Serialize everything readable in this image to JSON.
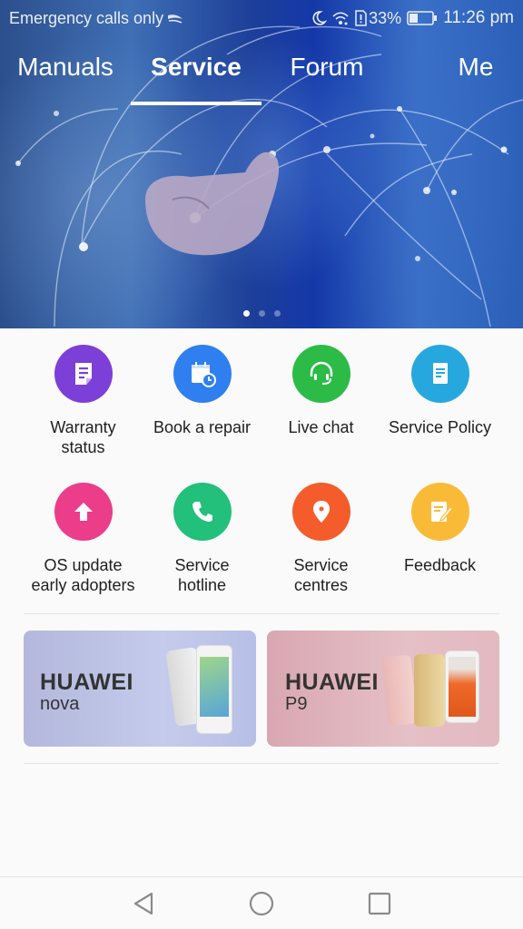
{
  "status_bar": {
    "carrier_text": "Emergency calls only",
    "battery_percent": "33%",
    "time": "11:26 pm",
    "icons": [
      "signal-swoosh-icon",
      "moon-icon",
      "wifi-icon",
      "sim-alert-icon",
      "battery-icon"
    ]
  },
  "tabs": [
    {
      "label": "Manuals",
      "active": false
    },
    {
      "label": "Service",
      "active": true
    },
    {
      "label": "Forum",
      "active": false
    },
    {
      "label": "Me",
      "active": false
    }
  ],
  "carousel": {
    "pages": 3,
    "active_index": 0
  },
  "service_items": [
    {
      "label": "Warranty status",
      "icon": "document-icon",
      "color": "#7c3fd8"
    },
    {
      "label": "Book a repair",
      "icon": "calendar-clock-icon",
      "color": "#2f7ff0"
    },
    {
      "label": "Live chat",
      "icon": "headset-icon",
      "color": "#2dbb47"
    },
    {
      "label": "Service Policy",
      "icon": "policy-document-icon",
      "color": "#26a8de"
    },
    {
      "label": "OS update early adopters",
      "icon": "upload-arrow-icon",
      "color": "#ec3d8a"
    },
    {
      "label": "Service hotline",
      "icon": "phone-icon",
      "color": "#22c07a"
    },
    {
      "label": "Service centres",
      "icon": "location-pin-icon",
      "color": "#f45d2b"
    },
    {
      "label": "Feedback",
      "icon": "edit-note-icon",
      "color": "#f9bb37"
    }
  ],
  "service_labels": {
    "warranty_l1": "Warranty",
    "warranty_l2": "status",
    "book": "Book a repair",
    "chat": "Live chat",
    "policy": "Service Policy",
    "os_l1": "OS update",
    "os_l2": "early adopters",
    "hotline_l1": "Service",
    "hotline_l2": "hotline",
    "centres_l1": "Service",
    "centres_l2": "centres",
    "feedback": "Feedback"
  },
  "banners": [
    {
      "brand": "HUAWEI",
      "model": "nova"
    },
    {
      "brand": "HUAWEI",
      "model": "P9"
    }
  ],
  "nav_bar": {
    "buttons": [
      "back",
      "home",
      "recents"
    ]
  }
}
